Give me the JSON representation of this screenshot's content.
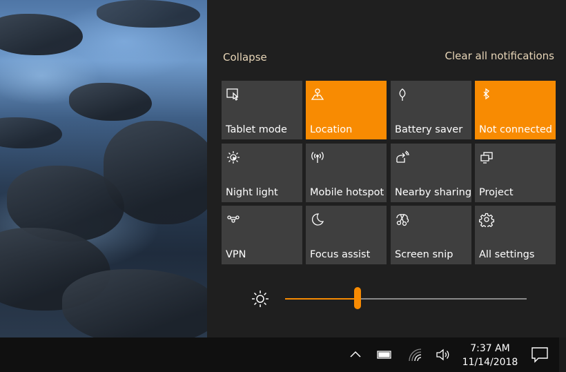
{
  "action_center": {
    "collapse_label": "Collapse",
    "clear_label": "Clear all notifications",
    "accent_color": "#f88b02",
    "tiles": [
      {
        "label": "Tablet mode",
        "icon": "tablet-mode-icon",
        "active": false
      },
      {
        "label": "Location",
        "icon": "location-icon",
        "active": true
      },
      {
        "label": "Battery saver",
        "icon": "battery-saver-icon",
        "active": false
      },
      {
        "label": "Not connected",
        "icon": "bluetooth-icon",
        "active": true
      },
      {
        "label": "Night light",
        "icon": "night-light-icon",
        "active": false
      },
      {
        "label": "Mobile hotspot",
        "icon": "mobile-hotspot-icon",
        "active": false
      },
      {
        "label": "Nearby sharing",
        "icon": "nearby-sharing-icon",
        "active": false
      },
      {
        "label": "Project",
        "icon": "project-icon",
        "active": false
      },
      {
        "label": "VPN",
        "icon": "vpn-icon",
        "active": false
      },
      {
        "label": "Focus assist",
        "icon": "focus-assist-icon",
        "active": false
      },
      {
        "label": "Screen snip",
        "icon": "screen-snip-icon",
        "active": false
      },
      {
        "label": "All settings",
        "icon": "settings-gear-icon",
        "active": false
      }
    ],
    "brightness": {
      "percent": 30
    }
  },
  "taskbar": {
    "time": "7:37 AM",
    "date": "11/14/2018"
  }
}
